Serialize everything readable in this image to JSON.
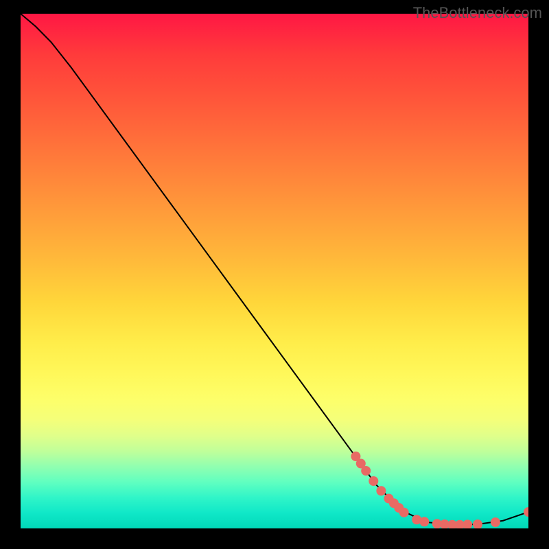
{
  "watermark": "TheBottleneck.com",
  "chart_data": {
    "type": "line",
    "title": "",
    "xlabel": "",
    "ylabel": "",
    "ylim": [
      0,
      100
    ],
    "xlim": [
      0,
      100
    ],
    "curve": [
      {
        "x": 0,
        "y": 100
      },
      {
        "x": 3,
        "y": 97.5
      },
      {
        "x": 6,
        "y": 94.5
      },
      {
        "x": 10,
        "y": 89.5
      },
      {
        "x": 20,
        "y": 76
      },
      {
        "x": 30,
        "y": 62.5
      },
      {
        "x": 40,
        "y": 49
      },
      {
        "x": 50,
        "y": 35.5
      },
      {
        "x": 60,
        "y": 22
      },
      {
        "x": 70,
        "y": 8.5
      },
      {
        "x": 75,
        "y": 3.5
      },
      {
        "x": 80,
        "y": 1.2
      },
      {
        "x": 85,
        "y": 0.7
      },
      {
        "x": 90,
        "y": 0.8
      },
      {
        "x": 95,
        "y": 1.5
      },
      {
        "x": 100,
        "y": 3.2
      }
    ],
    "markers": [
      {
        "x": 66,
        "y": 14.0
      },
      {
        "x": 67,
        "y": 12.6
      },
      {
        "x": 68,
        "y": 11.2
      },
      {
        "x": 69.5,
        "y": 9.2
      },
      {
        "x": 71,
        "y": 7.3
      },
      {
        "x": 72.5,
        "y": 5.8
      },
      {
        "x": 73.5,
        "y": 4.9
      },
      {
        "x": 74.5,
        "y": 4.0
      },
      {
        "x": 75.5,
        "y": 3.1
      },
      {
        "x": 78,
        "y": 1.7
      },
      {
        "x": 79.5,
        "y": 1.3
      },
      {
        "x": 82,
        "y": 0.9
      },
      {
        "x": 83.5,
        "y": 0.8
      },
      {
        "x": 85,
        "y": 0.7
      },
      {
        "x": 86.5,
        "y": 0.7
      },
      {
        "x": 88,
        "y": 0.75
      },
      {
        "x": 90,
        "y": 0.8
      },
      {
        "x": 93.5,
        "y": 1.2
      },
      {
        "x": 100,
        "y": 3.2
      }
    ],
    "description": "Bottleneck curve descending from top-left to a minimum around x≈85 then rising slightly, over a red-to-green vertical gradient background."
  }
}
